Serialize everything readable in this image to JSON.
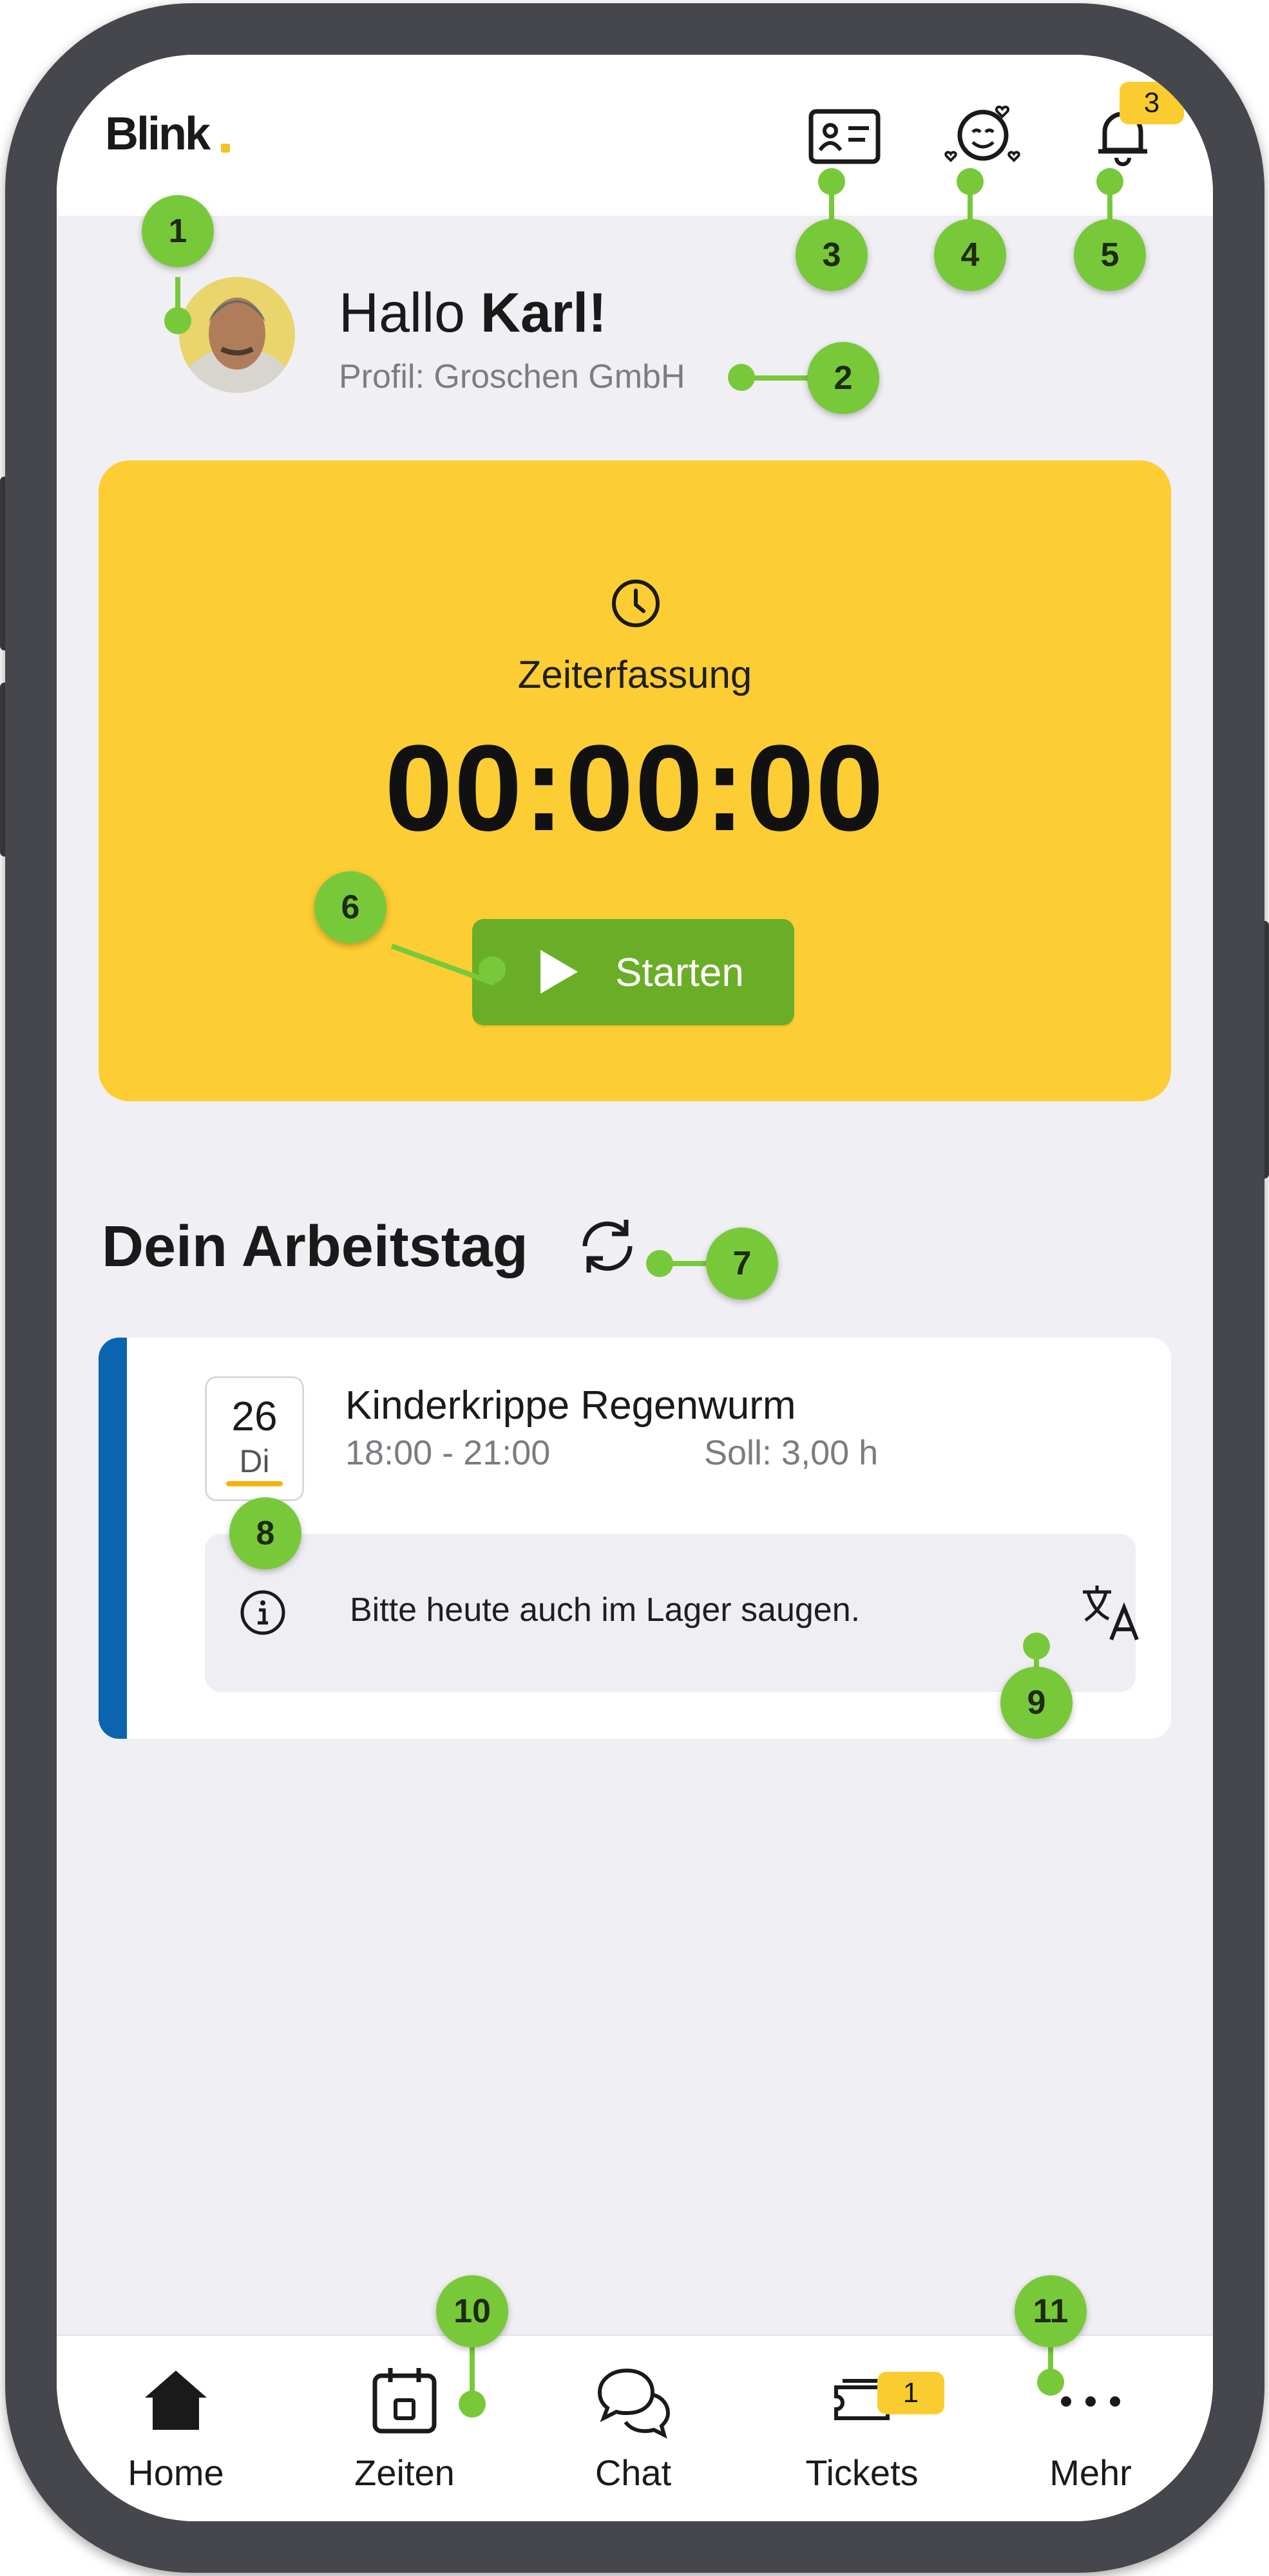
{
  "brand": {
    "logo_text": "Blink"
  },
  "header": {
    "notification_badge": "3",
    "icons": [
      "id-card-icon",
      "mood-icon",
      "bell-icon"
    ]
  },
  "greeting": {
    "hello": "Hallo ",
    "name": "Karl!",
    "profile": "Profil: Groschen GmbH"
  },
  "time_tracking": {
    "label": "Zeiterfassung",
    "timer": "00:00:00",
    "start_label": "Starten"
  },
  "workday": {
    "title": "Dein Arbeitstag",
    "shift": {
      "date_number": "26",
      "date_weekday": "Di",
      "location": "Kinderkrippe Regenwurm",
      "time": "18:00 - 21:00",
      "target": "Soll: 3,00 h",
      "note": "Bitte heute auch im Lager saugen."
    }
  },
  "bottom_nav": {
    "items": [
      {
        "label": "Home",
        "icon": "home-icon"
      },
      {
        "label": "Zeiten",
        "icon": "calendar-icon"
      },
      {
        "label": "Chat",
        "icon": "chat-icon"
      },
      {
        "label": "Tickets",
        "icon": "ticket-icon"
      },
      {
        "label": "Mehr",
        "icon": "more-icon"
      }
    ],
    "tickets_badge": "1"
  },
  "callouts": [
    "1",
    "2",
    "3",
    "4",
    "5",
    "6",
    "7",
    "8",
    "9",
    "10",
    "11"
  ],
  "colors": {
    "accent_yellow": "#fdcd34",
    "start_green": "#6aae27",
    "shift_blue": "#0a64b0",
    "callout_green": "#78c93a"
  }
}
